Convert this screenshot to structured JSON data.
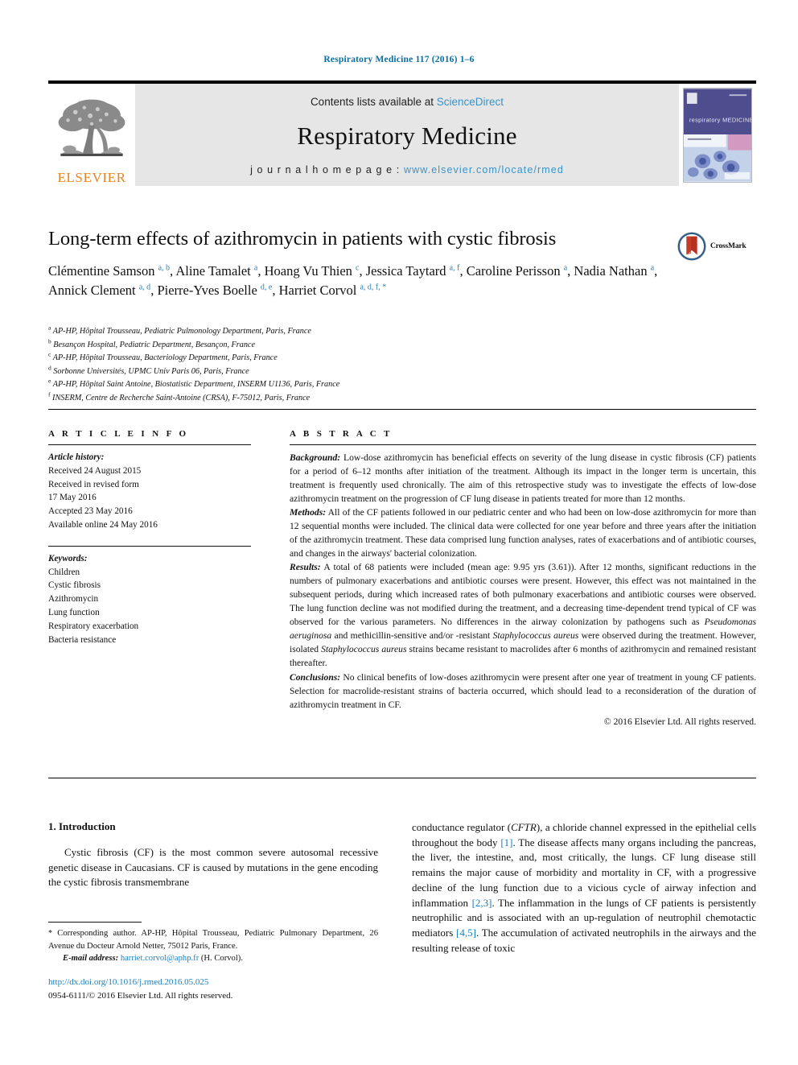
{
  "running_head": "Respiratory Medicine 117 (2016) 1–6",
  "masthead": {
    "contents_prefix": "Contents lists available at ",
    "sciencedirect": "ScienceDirect",
    "journal_title": "Respiratory Medicine",
    "homepage_prefix": "j o u r n a l   h o m e p a g e :   ",
    "homepage_url": "www.elsevier.com/locate/rmed",
    "elsevier_wordmark": "ELSEVIER",
    "link_color": "#3a93c9",
    "elsevier_orange": "#E8831D"
  },
  "article": {
    "title": "Long-term effects of azithromycin in patients with cystic fibrosis",
    "crossmark_label": "CrossMark",
    "authors_html": "Clémentine Samson <sup>a, b</sup>, Aline Tamalet <sup>a</sup>, Hoang Vu Thien <sup>c</sup>, Jessica Taytard <sup>a, f</sup>, Caroline Perisson <sup>a</sup>, Nadia Nathan <sup>a</sup>, Annick Clement <sup>a, d</sup>, Pierre-Yves Boelle <sup>d, e</sup>, Harriet Corvol <sup>a, d, f, *</sup>",
    "affiliations": [
      {
        "mark": "a",
        "text": "AP-HP, Hôpital Trousseau, Pediatric Pulmonology Department, Paris, France"
      },
      {
        "mark": "b",
        "text": "Besançon Hospital, Pediatric Department, Besançon, France"
      },
      {
        "mark": "c",
        "text": "AP-HP, Hôpital Trousseau, Bacteriology Department, Paris, France"
      },
      {
        "mark": "d",
        "text": "Sorbonne Universités, UPMC Univ Paris 06, Paris, France"
      },
      {
        "mark": "e",
        "text": "AP-HP, Hôpital Saint Antoine, Biostatistic Department, INSERM U1136, Paris, France"
      },
      {
        "mark": "f",
        "text": "INSERM, Centre de Recherche Saint-Antoine (CRSA), F-75012, Paris, France"
      }
    ]
  },
  "article_info": {
    "kicker": "A R T I C L E   I N F O",
    "history_label": "Article history:",
    "history_lines": [
      "Received 24 August 2015",
      "Received in revised form",
      "17 May 2016",
      "Accepted 23 May 2016",
      "Available online 24 May 2016"
    ],
    "keywords_label": "Keywords:",
    "keywords": [
      "Children",
      "Cystic fibrosis",
      "Azithromycin",
      "Lung function",
      "Respiratory exacerbation",
      "Bacteria resistance"
    ]
  },
  "abstract": {
    "kicker": "A B S T R A C T",
    "background_label": "Background:",
    "background_text": " Low-dose azithromycin has beneficial effects on severity of the lung disease in cystic fibrosis (CF) patients for a period of 6–12 months after initiation of the treatment. Although its impact in the longer term is uncertain, this treatment is frequently used chronically. The aim of this retrospective study was to investigate the effects of low-dose azithromycin treatment on the progression of CF lung disease in patients treated for more than 12 months.",
    "methods_label": "Methods:",
    "methods_text": " All of the CF patients followed in our pediatric center and who had been on low-dose azithromycin for more than 12 sequential months were included. The clinical data were collected for one year before and three years after the initiation of the azithromycin treatment. These data comprised lung function analyses, rates of exacerbations and of antibiotic courses, and changes in the airways' bacterial colonization.",
    "results_label": "Results:",
    "results_html": " A total of 68 patients were included (mean age: 9.95 yrs (3.61)). After 12 months, significant reductions in the numbers of pulmonary exacerbations and antibiotic courses were present. However, this effect was not maintained in the subsequent periods, during which increased rates of both pulmonary exacerbations and antibiotic courses were observed. The lung function decline was not modified during the treatment, and a decreasing time-dependent trend typical of CF was observed for the various parameters. No differences in the airway colonization by pathogens such as <i>Pseudomonas aeruginosa</i> and methicillin-sensitive and/or -resistant <i>Staphylococcus aureus</i> were observed during the treatment. However, isolated <i>Staphylococcus aureus</i> strains became resistant to macrolides after 6 months of azithromycin and remained resistant thereafter.",
    "conclusions_label": "Conclusions:",
    "conclusions_text": " No clinical benefits of low-doses azithromycin were present after one year of treatment in young CF patients. Selection for macrolide-resistant strains of bacteria occurred, which should lead to a reconsideration of the duration of azithromycin treatment in CF.",
    "copyright": "© 2016 Elsevier Ltd. All rights reserved."
  },
  "introduction": {
    "heading": "1. Introduction",
    "left_html": "Cystic fibrosis (CF) is the most common severe autosomal recessive genetic disease in Caucasians. CF is caused by mutations in the gene encoding the cystic fibrosis transmembrane",
    "right_html": "conductance regulator (<i>CFTR</i>), a chloride channel expressed in the epithelial cells throughout the body <span class=\"ref\">[1]</span>. The disease affects many organs including the pancreas, the liver, the intestine, and, most critically, the lungs. CF lung disease still remains the major cause of morbidity and mortality in CF, with a progressive decline of the lung function due to a vicious cycle of airway infection and inflammation <span class=\"ref\">[2,3]</span>. The inflammation in the lungs of CF patients is persistently neutrophilic and is associated with an up-regulation of neutrophil chemotactic mediators <span class=\"ref\">[4,5]</span>. The accumulation of activated neutrophils in the airways and the resulting release of toxic"
  },
  "footnotes": {
    "corresponding_html": "<span class=\"star\">*</span> Corresponding author. AP-HP, Hôpital Trousseau, Pediatric Pulmonary Department, 26 Avenue du Docteur Arnold Netter, 75012 Paris, France.",
    "email_label": "E-mail address:",
    "email": "harriet.corvol@aphp.fr",
    "email_suffix": " (H. Corvol).",
    "doi": "http://dx.doi.org/10.1016/j.rmed.2016.05.025",
    "issn_line": "0954-6111/© 2016 Elsevier Ltd. All rights reserved."
  }
}
